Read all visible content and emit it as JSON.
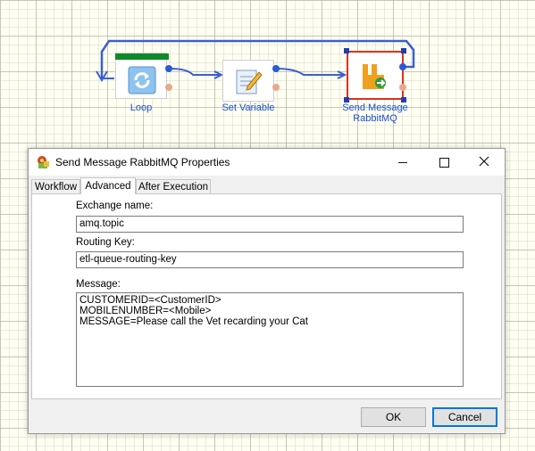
{
  "workflow": {
    "nodes": [
      {
        "label": "Loop",
        "icon": "loop-icon"
      },
      {
        "label": "Set Variable",
        "icon": "set-variable-icon"
      },
      {
        "label": "Send Message\nRabbitMQ",
        "icon": "rabbitmq-icon"
      }
    ],
    "colors": {
      "wire": "#3b5fd1",
      "label": "#1a4fd6",
      "selection": "#e0301e"
    }
  },
  "dialog": {
    "title": "Send Message RabbitMQ Properties",
    "icon": "rabbitmq-settings-icon",
    "controls": {
      "minimize": "minimize-icon",
      "maximize": "maximize-icon",
      "close": "close-icon"
    },
    "tabs": [
      {
        "label": "Workflow",
        "active": false
      },
      {
        "label": "Advanced",
        "active": true
      },
      {
        "label": "After Execution",
        "active": false
      }
    ],
    "fields": {
      "exchange_label": "Exchange name:",
      "exchange_value": "amq.topic",
      "routing_label": "Routing Key:",
      "routing_value": "etl-queue-routing-key",
      "message_label": "Message:",
      "message_value": "CUSTOMERID=<CustomerID>\nMOBILENUMBER=<Mobile>\nMESSAGE=Please call the Vet recarding your Cat"
    },
    "buttons": {
      "ok": "OK",
      "cancel": "Cancel"
    }
  }
}
